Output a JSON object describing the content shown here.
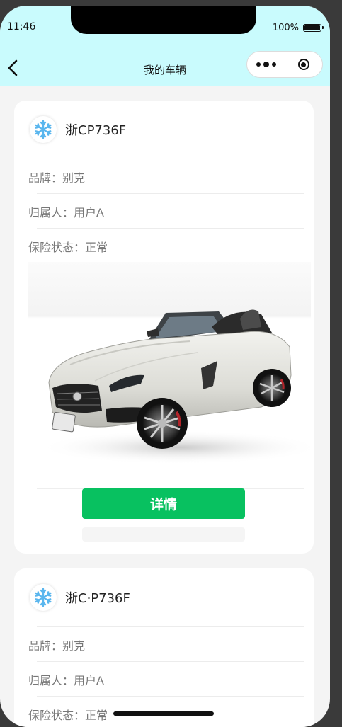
{
  "status_bar": {
    "time": "11:46",
    "battery": "100%"
  },
  "nav": {
    "title": "我的车辆",
    "back_icon": "chevron-left-icon",
    "more_icon": "more-dots-icon",
    "close_icon": "target-circle-icon"
  },
  "vehicles": [
    {
      "plate": "浙CP736F",
      "brand_row": "品牌：别克",
      "owner_row": "归属人：用户A",
      "insurance_row": "保险状态：正常",
      "avatar_icon": "snowflake-icon",
      "photo": "white-convertible-sports-car",
      "detail_label": "详情"
    },
    {
      "plate": "浙C·P736F",
      "brand_row": "品牌：别克",
      "owner_row": "归属人：用户A",
      "insurance_row": "保险状态：正常",
      "avatar_icon": "snowflake-icon"
    }
  ],
  "colors": {
    "header_bg": "#c9fbfd",
    "primary_button": "#08c160",
    "page_bg": "#f4f4f4",
    "snowflake": "#5ab6ee"
  }
}
